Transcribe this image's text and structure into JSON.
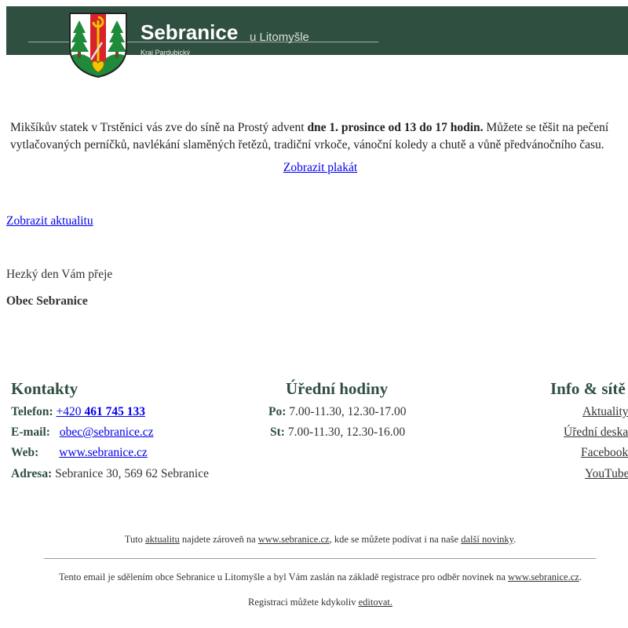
{
  "header": {
    "title": "Sebranice",
    "subtitle": "u Litomyšle",
    "region": "Kraj Pardubický",
    "background_color": "#2f4f40"
  },
  "article": {
    "intro_text_1": "Mikšíkův statek v Trstěnici vás zve do síně na Prostý advent ",
    "intro_bold": "dne 1. prosince od 13 do 17 hodin.",
    "intro_text_2": " Můžete se těšit na pečení",
    "intro_line2": "vytlačovaných perníčků, navlékání slaměných řetězů, tradiční vrkoče, vánoční koledy a chutě a vůně předvánočního času.",
    "poster_link": "Zobrazit plakát",
    "news_link": "Zobrazit aktualitu",
    "greeting": "Hezký den Vám přeje",
    "signature": "Obec Sebranice"
  },
  "contacts": {
    "title": "Kontakty",
    "phone_label": "Telefon:",
    "phone_prefix": "+420 ",
    "phone_number": "461 745 133",
    "email_label": "E-mail:",
    "email": "obec@sebranice.cz",
    "web_label": "Web:",
    "web": "www.sebranice.cz",
    "address_label": "Adresa:",
    "address": "Sebranice 30, 569 62 Sebranice"
  },
  "office_hours": {
    "title": "Úřední hodiny",
    "mon_label": "Po:",
    "mon_hours": "7.00-11.30, 12.30-17.00",
    "wed_label": "St:",
    "wed_hours": "7.00-11.30, 12.30-16.00"
  },
  "info": {
    "title": "Info & sítě",
    "links": [
      "Aktuality",
      "Úřední deska",
      "Facebook",
      "YouTube"
    ]
  },
  "notes": {
    "n1_a": "Tuto ",
    "n1_link1": "aktualitu",
    "n1_b": " najdete zároveň na ",
    "n1_link2": "www.sebranice.cz",
    "n1_c": ", kde se můžete podívat i na naše ",
    "n1_link3": "další novinky",
    "n1_d": ".",
    "n2_a": "Tento email je sdělením obce Sebranice u Litomyšle a byl Vám zaslán na základě registrace pro odběr novinek na ",
    "n2_link": "www.sebranice.cz",
    "n2_b": ".",
    "n3_a": "Registraci můžete kdykoliv ",
    "n3_link": "editovat."
  }
}
